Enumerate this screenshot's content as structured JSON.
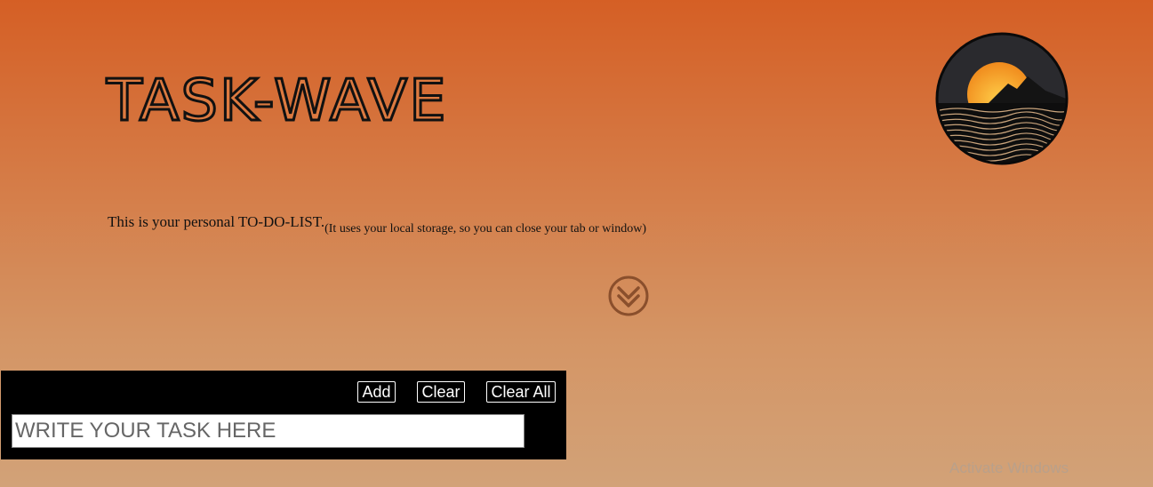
{
  "header": {
    "title": "TASK-WAVE"
  },
  "intro": {
    "main_text": "This is your personal TO-DO-LIST.",
    "note_text": "(It uses your local storage, so you can close your tab or window)"
  },
  "task_panel": {
    "add_label": "Add",
    "clear_label": "Clear",
    "clear_all_label": "Clear All",
    "input_placeholder": "WRITE YOUR TASK HERE",
    "input_value": ""
  },
  "os_watermark": {
    "text": "Activate Windows"
  },
  "icons": {
    "logo": "sunset-waves-logo-icon",
    "scroll": "double-chevron-down-icon"
  },
  "colors": {
    "background_top": "#d55f25",
    "background_bottom": "#d2a278",
    "panel": "#000000",
    "accent_icon": "#8a4f2c"
  }
}
